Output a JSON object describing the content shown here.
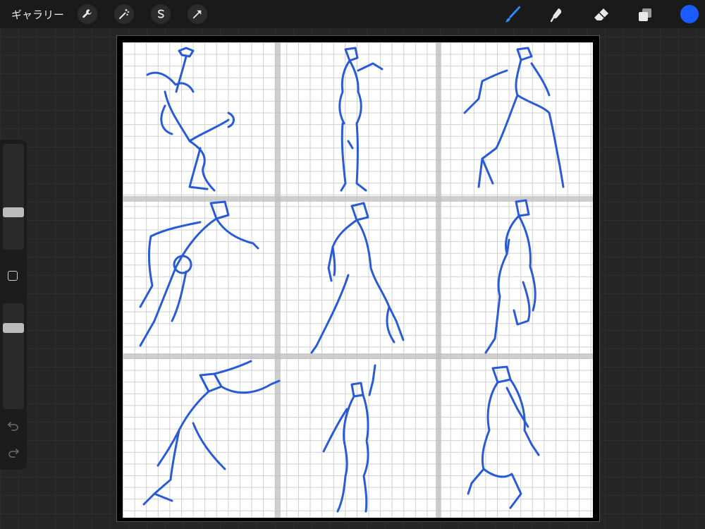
{
  "toolbar": {
    "gallery_label": "ギャラリー",
    "left_tools": [
      "wrench-icon",
      "magic-wand-icon",
      "selection-s-icon",
      "transform-arrow-icon"
    ],
    "right_tools": [
      "brush-icon",
      "smudge-icon",
      "eraser-icon",
      "layers-icon"
    ],
    "active_tool": "brush-icon",
    "color": "#1a5cff"
  },
  "sidebar": {
    "brush_size_level": 0.63,
    "opacity_level": 0.23
  },
  "canvas": {
    "sketch_color": "#2a5bd7",
    "panels": 9,
    "panel_layout": "3x3"
  }
}
